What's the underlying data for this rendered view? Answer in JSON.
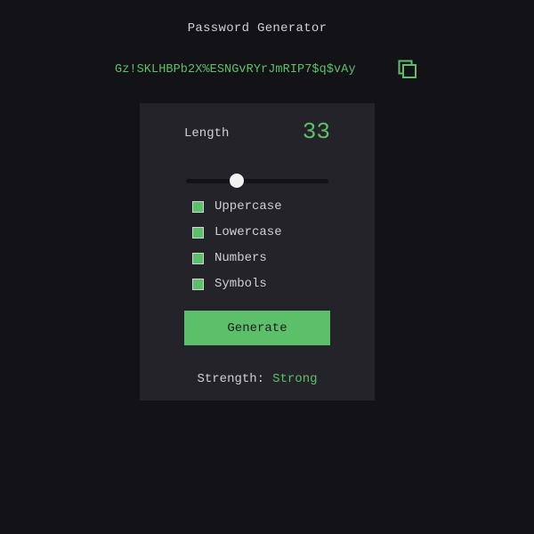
{
  "app": {
    "title": "Password Generator"
  },
  "password": {
    "value": "Gz!SKLHBPb2X%ESNGvRYrJmRIP7$q$vAy",
    "copy_icon": "copy-icon"
  },
  "length": {
    "label": "Length",
    "value": "33",
    "slider_fraction": 0.34
  },
  "options": [
    {
      "label": "Uppercase",
      "checked": true
    },
    {
      "label": "Lowercase",
      "checked": true
    },
    {
      "label": "Numbers",
      "checked": true
    },
    {
      "label": "Symbols",
      "checked": true
    }
  ],
  "generate": {
    "label": "Generate"
  },
  "strength": {
    "label": "Strength:",
    "value": "Strong"
  },
  "colors": {
    "background": "#131217",
    "card": "#24232a",
    "accent": "#5cc06a",
    "text": "#cfcfd4"
  }
}
